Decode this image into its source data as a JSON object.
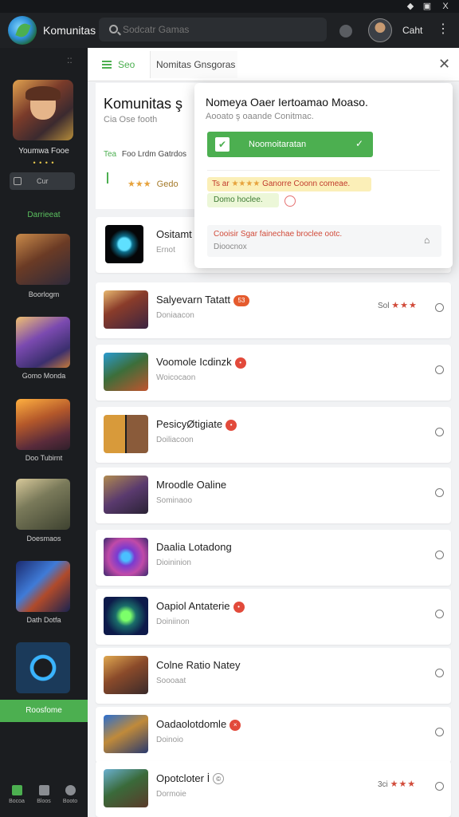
{
  "window": {
    "ctrl_1": "◆",
    "ctrl_2": "▣",
    "ctrl_3": "X"
  },
  "header": {
    "app_title": "Komunitas",
    "search_placeholder": "Sodcatr Gamas",
    "user_name": "Caht",
    "more": "⋮"
  },
  "sidebar": {
    "more": "::",
    "featured_label": "Youmwa Fooe",
    "dots": "• • • •",
    "chip_label": "Cur",
    "section_title": "Darrieeat",
    "items": [
      {
        "label": "Boorlogm"
      },
      {
        "label": "Gomo Monda"
      },
      {
        "label": "Doo Tubirnt"
      },
      {
        "label": "Doesmaos"
      },
      {
        "label": "Dath Dotfa"
      }
    ],
    "active_label": "Roosfome",
    "bottom_nav": [
      {
        "label": "Bocoa",
        "color": "#4caf50"
      },
      {
        "label": "Bloos",
        "color": "#8a8d92"
      },
      {
        "label": "Booto",
        "color": "#8a8d92"
      }
    ]
  },
  "panel": {
    "head_green": "Seo",
    "head_title": "Nomitas Gnsgoras",
    "close": "✕"
  },
  "profile": {
    "title": "Komunitas ş",
    "subtitle": "Cia Ose footh",
    "meta_green": "Tea",
    "meta_text": "Foo Lrdm Gatrdos",
    "stars": "★★★",
    "stars_label": "Gedo"
  },
  "games": [
    {
      "title": "Ositamt",
      "sub": "Ernot",
      "badge": "",
      "rating": ""
    },
    {
      "title": "Salyevarn Tatatt",
      "sub": "Doniaacon",
      "badge": "53",
      "badge_style": "orange",
      "rating": "★★★",
      "rating_label": "Sol"
    },
    {
      "title": "Voomole Icdinzk",
      "sub": "Woicocaon",
      "badge": "•",
      "rating": ""
    },
    {
      "title": "PesicyØtigiate",
      "sub": "Doiliacoon",
      "badge": "•",
      "rating": ""
    },
    {
      "title": "Mroodle Oaline",
      "sub": "Sominaoo",
      "badge": "",
      "rating": ""
    },
    {
      "title": "Daalia Lotadong",
      "sub": "Dioininion",
      "badge": "",
      "rating": ""
    },
    {
      "title": "Oapiol Antaterie",
      "sub": "Doiniinon",
      "badge": "•",
      "rating": ""
    },
    {
      "title": "Colne Ratio Natey",
      "sub": "Soooaat",
      "badge": "",
      "rating": ""
    },
    {
      "title": "Oadaolotdomle",
      "sub": "Doinoio",
      "badge": "×",
      "rating": ""
    },
    {
      "title": "Opotcloter İ",
      "sub": "Dormoie",
      "badge": "©",
      "badge_style": "ring",
      "rating": "★★★",
      "rating_label": "3ci"
    }
  ],
  "popup": {
    "title": "Nomeya Oaer Iertoamao Moaso.",
    "subtitle": "Aooato ş oaande Conitmac.",
    "button_label": "Noomoitaratan",
    "button_check": "✔",
    "button_chevron": "✓",
    "warn_stars": "★★★★",
    "warn_text_pre": "Ts ar",
    "warn_text": "Ganorre Coonn comeae.",
    "note_text": "Domo hoclee.",
    "alert_title": "Cooisir Sgar fainechae broclee ootc.",
    "alert_sub": "Dioocnox",
    "alert_icon": "⌂"
  }
}
